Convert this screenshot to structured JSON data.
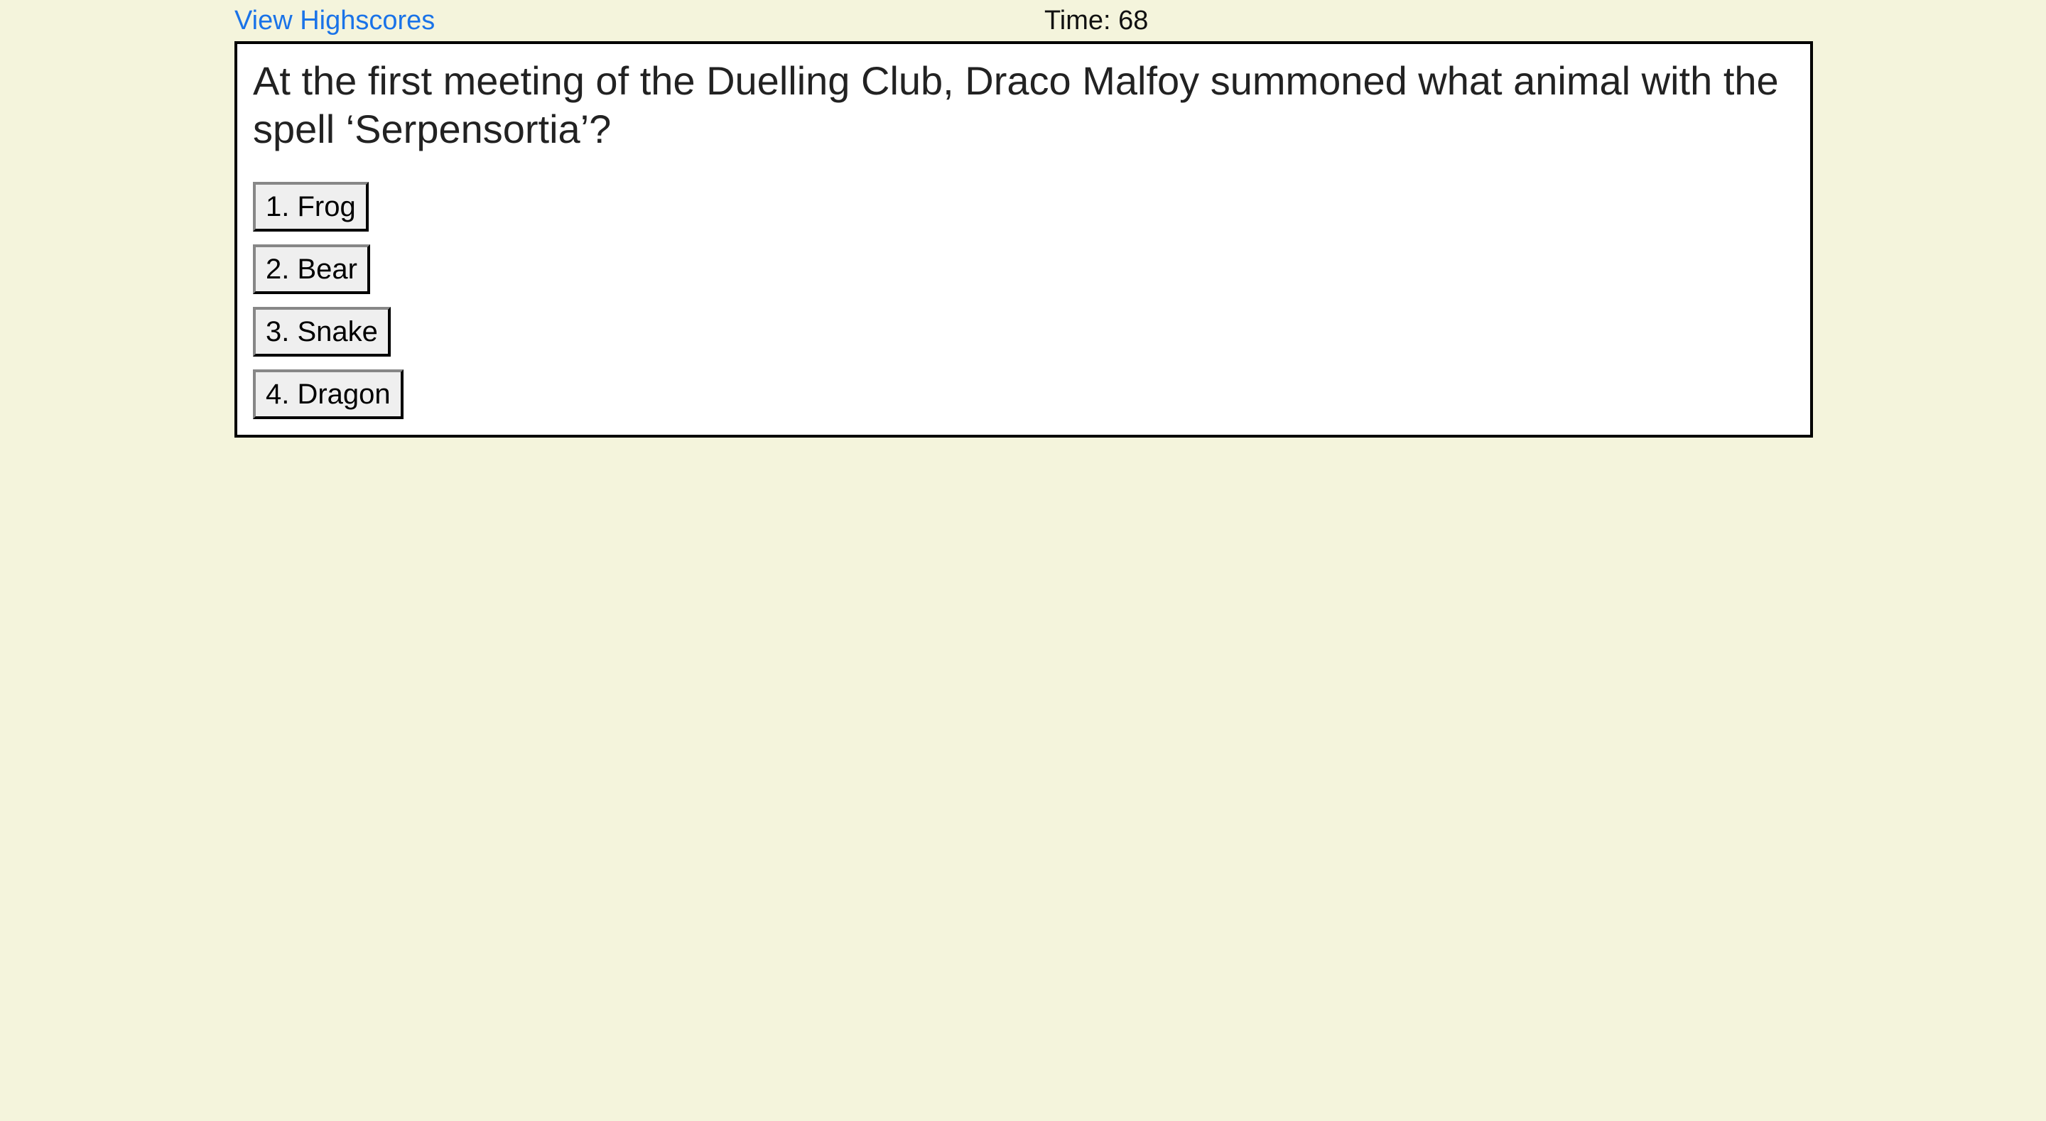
{
  "header": {
    "highscores_link": "View Highscores",
    "timer": "Time: 68"
  },
  "quiz": {
    "question": "At the first meeting of the Duelling Club, Draco Malfoy summoned what animal with the spell ‘Serpensortia’?",
    "answers": [
      {
        "label": "1. Frog"
      },
      {
        "label": "2. Bear"
      },
      {
        "label": "3. Snake"
      },
      {
        "label": "4. Dragon"
      }
    ]
  },
  "colors": {
    "background": "#f4f4dc",
    "link": "#1a73e8",
    "card_border": "#000000"
  }
}
